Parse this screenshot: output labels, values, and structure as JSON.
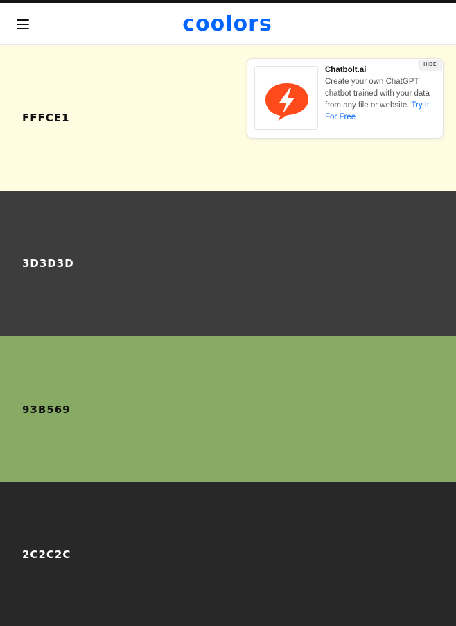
{
  "app": {
    "logo_text": "coolors",
    "brand_color": "#0066ff"
  },
  "header": {
    "menu_icon": "hamburger-menu-icon"
  },
  "palette": [
    {
      "hex": "FFFCE1",
      "color": "#FFFCE1",
      "text_color": "#111111"
    },
    {
      "hex": "3D3D3D",
      "color": "#3D3D3D",
      "text_color": "#FFFFFF"
    },
    {
      "hex": "93B569",
      "color": "#87AA65",
      "text_color": "#111111"
    },
    {
      "hex": "2C2C2C",
      "color": "#282828",
      "text_color": "#FFFFFF"
    }
  ],
  "ad": {
    "hide_label": "HIDE",
    "title": "Chatbolt.ai",
    "body": "Create your own ChatGPT chatbot trained with your data from any file or website.",
    "cta": "Try It For Free",
    "icon": "lightning-bolt-logo-icon",
    "icon_color": "#FF4A1C"
  }
}
